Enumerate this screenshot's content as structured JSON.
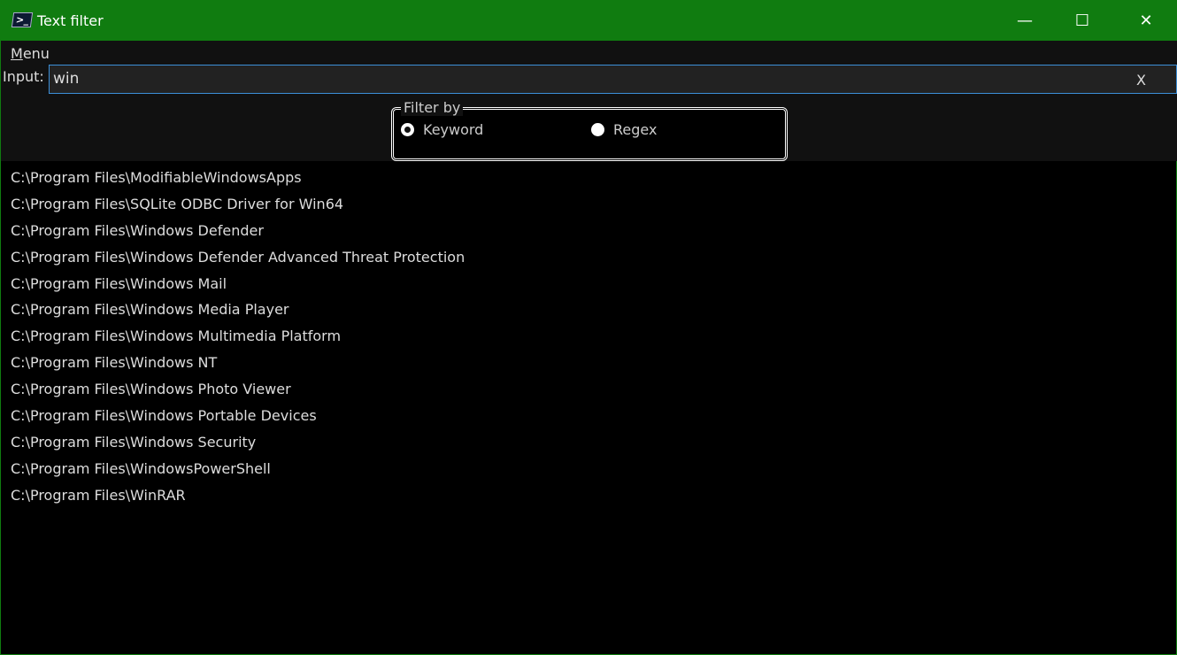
{
  "window": {
    "title": "Text filter",
    "minimize": "—",
    "maximize": "☐",
    "close": "✕"
  },
  "menu": {
    "label_first": "M",
    "label_rest": "enu"
  },
  "input": {
    "label": "Input:",
    "value": "win",
    "clear": "X"
  },
  "filter": {
    "legend": "Filter by",
    "options": [
      {
        "label": "Keyword",
        "selected": true
      },
      {
        "label": "Regex",
        "selected": false
      }
    ]
  },
  "results": [
    "C:\\Program Files\\ModifiableWindowsApps",
    "C:\\Program Files\\SQLite ODBC Driver for Win64",
    "C:\\Program Files\\Windows Defender",
    "C:\\Program Files\\Windows Defender Advanced Threat Protection",
    "C:\\Program Files\\Windows Mail",
    "C:\\Program Files\\Windows Media Player",
    "C:\\Program Files\\Windows Multimedia Platform",
    "C:\\Program Files\\Windows NT",
    "C:\\Program Files\\Windows Photo Viewer",
    "C:\\Program Files\\Windows Portable Devices",
    "C:\\Program Files\\Windows Security",
    "C:\\Program Files\\WindowsPowerShell",
    "C:\\Program Files\\WinRAR"
  ]
}
